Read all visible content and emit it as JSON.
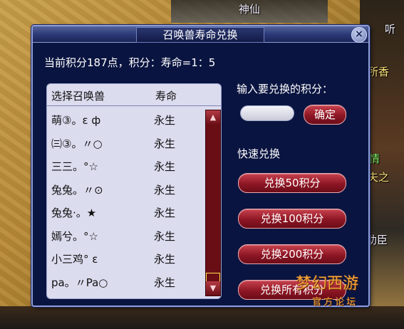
{
  "world": {
    "text_top": "神仙",
    "text_right_1": "听",
    "text_right_2": "所香",
    "text_right_3": "情",
    "text_right_4": "夫之",
    "text_right_5": "助臣",
    "watermark": "梦幻西游",
    "watermark_sub": "官方论坛"
  },
  "dialog": {
    "title": "召唤兽寿命兑换",
    "close_label": "×",
    "points_line": "当前积分187点，积分：寿命=1：5",
    "list": {
      "header_name": "选择召唤兽",
      "header_life": "寿命",
      "rows": [
        {
          "name": "萌③。ε ф",
          "life": "永生"
        },
        {
          "name": "㈢③。〃○",
          "life": "永生"
        },
        {
          "name": "三三。°☆",
          "life": "永生"
        },
        {
          "name": "兔兔。〃⊙",
          "life": "永生"
        },
        {
          "name": "兔兔·。★",
          "life": "永生"
        },
        {
          "name": "嫣兮。°☆",
          "life": "永生"
        },
        {
          "name": "小三鸡° ε",
          "life": "永生"
        },
        {
          "name": "pa。〃Pa○",
          "life": "永生"
        }
      ],
      "scroll_up": "▲",
      "scroll_down": "▼"
    },
    "prompt": "输入要兑换的积分：",
    "input_value": "",
    "confirm_label": "确定",
    "quick_label": "快速兑换",
    "buttons": {
      "ex50": "兑换50积分",
      "ex100": "兑换100积分",
      "ex200": "兑换200积分",
      "exall": "兑换所有积分"
    }
  }
}
